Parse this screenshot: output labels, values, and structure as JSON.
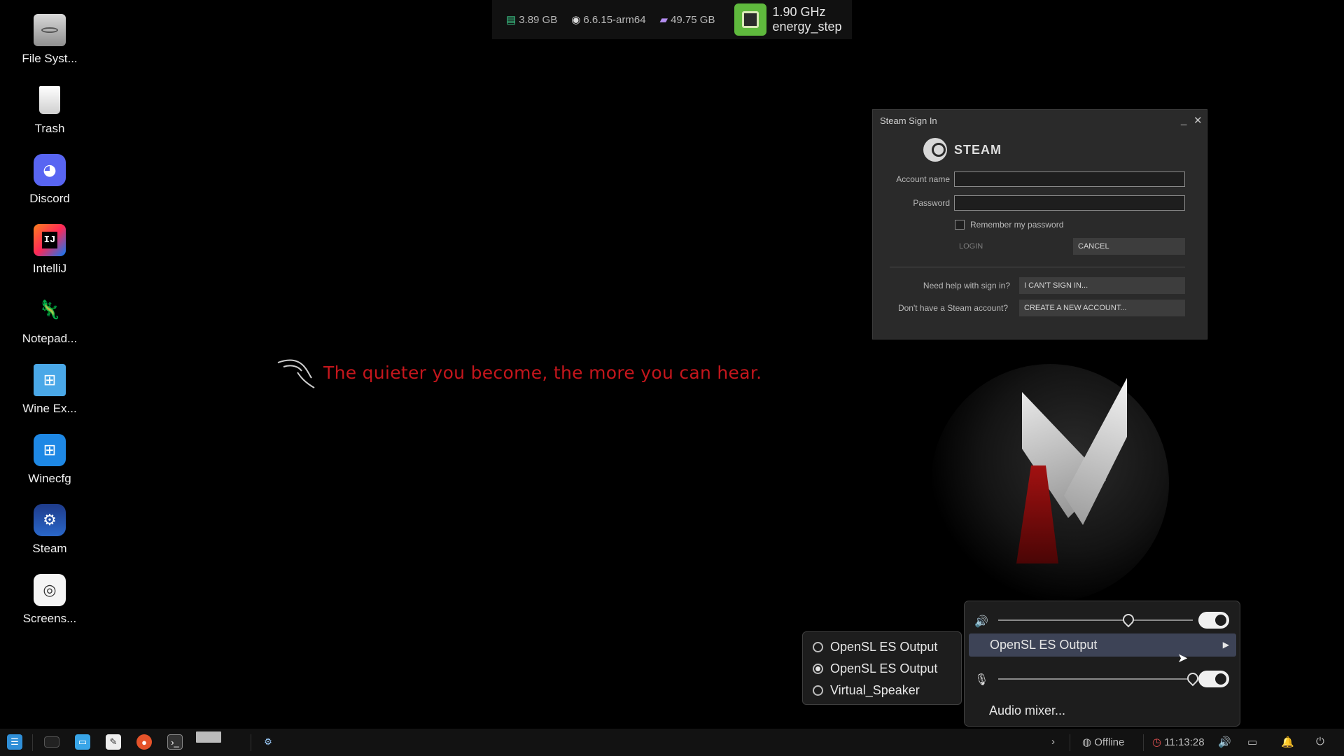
{
  "desktop": {
    "icons": [
      {
        "label": "File Syst...",
        "icon": "hard-drive-icon"
      },
      {
        "label": "Trash",
        "icon": "trash-icon"
      },
      {
        "label": "Discord",
        "icon": "discord-icon"
      },
      {
        "label": "IntelliJ",
        "icon": "intellij-icon"
      },
      {
        "label": "Notepad...",
        "icon": "notepadqq-icon"
      },
      {
        "label": "Wine Ex...",
        "icon": "wine-explorer-icon"
      },
      {
        "label": "Winecfg",
        "icon": "winecfg-icon"
      },
      {
        "label": "Steam",
        "icon": "steam-icon"
      },
      {
        "label": "Screens...",
        "icon": "screenshot-icon"
      }
    ],
    "slogan": "The quieter you become, the more you can hear."
  },
  "monitor": {
    "ram": "3.89 GB",
    "kernel": "6.6.15-arm64",
    "disk": "49.75 GB",
    "cpu_freq": "1.90 GHz",
    "cpu_governor": "energy_step"
  },
  "steam_dialog": {
    "title": "Steam Sign In",
    "brand": "STEAM",
    "account_label": "Account name",
    "account_value": "",
    "password_label": "Password",
    "password_value": "",
    "remember_label": "Remember my password",
    "login_label": "LOGIN",
    "cancel_label": "CANCEL",
    "help_question": "Need help with sign in?",
    "help_button": "I CAN'T SIGN IN...",
    "account_question": "Don't have a Steam account?",
    "create_button": "CREATE A NEW ACCOUNT..."
  },
  "audio": {
    "output_volume": 0.67,
    "output_enabled": true,
    "selected_output": "OpenSL ES Output",
    "input_volume": 1.0,
    "input_enabled": true,
    "mixer_label": "Audio mixer...",
    "devices": [
      {
        "label": "OpenSL ES Output",
        "selected": false
      },
      {
        "label": "OpenSL ES Output",
        "selected": true
      },
      {
        "label": "Virtual_Speaker",
        "selected": false
      }
    ]
  },
  "taskbar": {
    "network_status": "Offline",
    "clock": "11:13:28"
  }
}
